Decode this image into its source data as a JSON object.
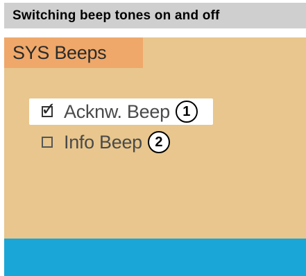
{
  "header": {
    "title": "Switching beep tones on and off"
  },
  "screen": {
    "title": "SYS Beeps",
    "options": [
      {
        "label": "Acknw. Beep",
        "checked": true,
        "callout": "1"
      },
      {
        "label": "Info Beep",
        "checked": false,
        "callout": "2"
      }
    ]
  },
  "colors": {
    "screen_background": "#e8c68d",
    "title_background": "#efa869",
    "bottom_bar": "#1aa6d6",
    "header_bar": "#cfcfcf"
  },
  "icons": {
    "checked": "checkmark-icon",
    "unchecked": "empty-checkbox-icon",
    "callout": "numbered-circle-icon"
  }
}
